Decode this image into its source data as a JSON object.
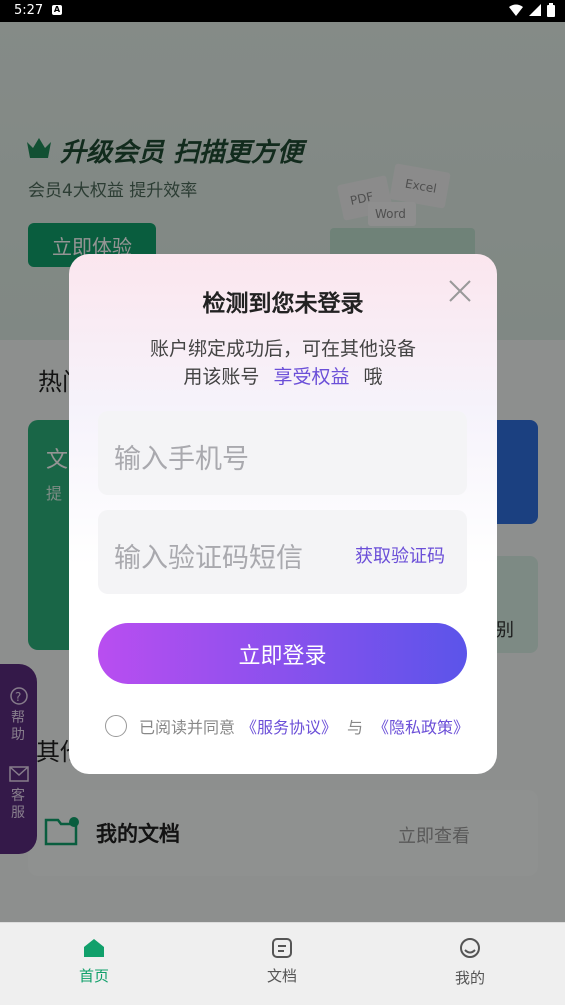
{
  "status_bar": {
    "time": "5:27",
    "notif_badge": "A"
  },
  "banner": {
    "title": "升级会员 扫描更方便",
    "subtitle": "会员4大权益 提升效率",
    "try_button": "立即体验",
    "doc_labels": [
      "PDF",
      "Excel",
      "Word"
    ]
  },
  "hot_section": {
    "title": "热门",
    "card_title": "文",
    "card_sub": "提",
    "side_card_label": "别"
  },
  "other_section": {
    "title": "其他"
  },
  "my_docs": {
    "label": "我的文档",
    "view_button": "立即查看"
  },
  "helper": {
    "help": "帮助",
    "service": "客服"
  },
  "modal": {
    "title": "检测到您未登录",
    "desc_line1": "账户绑定成功后，可在其他设备",
    "desc_line2_prefix": "用该账号",
    "desc_line2_link": "享受权益",
    "desc_line2_suffix": "哦",
    "phone_placeholder": "输入手机号",
    "code_placeholder": "输入验证码短信",
    "get_code_button": "获取验证码",
    "login_button": "立即登录",
    "agree_text": "已阅读并同意",
    "service_agreement": "《服务协议》",
    "and_text": "与",
    "privacy_policy": "《隐私政策》"
  },
  "tabbar": {
    "items": [
      {
        "label": "首页",
        "active": true
      },
      {
        "label": "文档",
        "active": false
      },
      {
        "label": "我的",
        "active": false
      }
    ]
  },
  "colors": {
    "accent_green": "#11a06b",
    "accent_purple": "#6b4fd8",
    "login_gradient_start": "#b94ef0",
    "login_gradient_end": "#5b54ea"
  }
}
